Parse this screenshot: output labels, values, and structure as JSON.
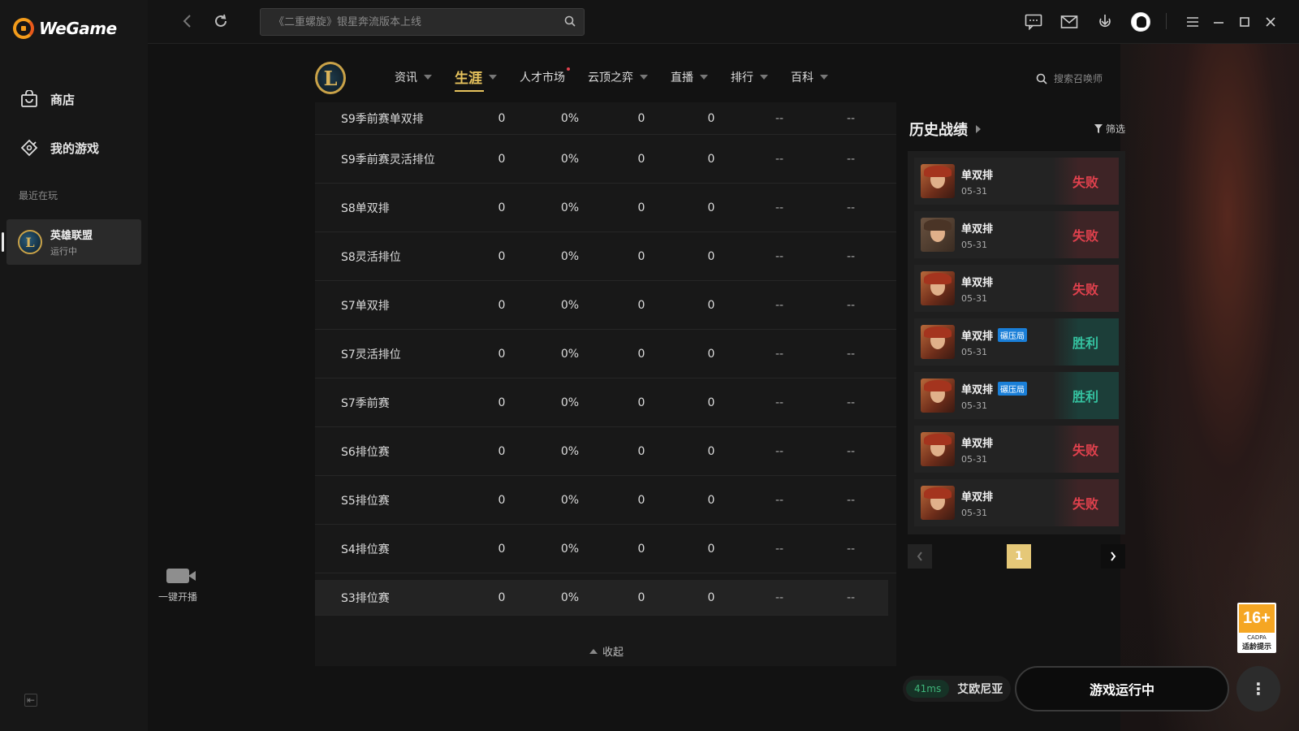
{
  "app": {
    "name": "WeGame"
  },
  "sidebar": {
    "items": [
      {
        "label": "商店",
        "icon": "store-bag-icon"
      },
      {
        "label": "我的游戏",
        "icon": "gamepad-icon"
      }
    ],
    "recent_label": "最近在玩",
    "recent_game": {
      "title": "英雄联盟",
      "status": "运行中",
      "icon": "lol-logo"
    }
  },
  "topbar": {
    "search_placeholder": "《二重螺旋》银星奔流版本上线"
  },
  "lol": {
    "tabs": [
      {
        "label": "资讯",
        "caret": true
      },
      {
        "label": "生涯",
        "caret": true,
        "active": true
      },
      {
        "label": "人才市场",
        "caret": false,
        "dot": true
      },
      {
        "label": "云顶之弈",
        "caret": true
      },
      {
        "label": "直播",
        "caret": true
      },
      {
        "label": "排行",
        "caret": true
      },
      {
        "label": "百科",
        "caret": true
      }
    ],
    "summoner_search_placeholder": "搜索召唤师"
  },
  "career_table": {
    "rows": [
      {
        "season": "S9季前赛单双排",
        "v1": "0",
        "v2": "0%",
        "v3": "0",
        "v4": "0",
        "v5": "--",
        "v6": "--"
      },
      {
        "season": "S9季前赛灵活排位",
        "v1": "0",
        "v2": "0%",
        "v3": "0",
        "v4": "0",
        "v5": "--",
        "v6": "--"
      },
      {
        "season": "S8单双排",
        "v1": "0",
        "v2": "0%",
        "v3": "0",
        "v4": "0",
        "v5": "--",
        "v6": "--"
      },
      {
        "season": "S8灵活排位",
        "v1": "0",
        "v2": "0%",
        "v3": "0",
        "v4": "0",
        "v5": "--",
        "v6": "--"
      },
      {
        "season": "S7单双排",
        "v1": "0",
        "v2": "0%",
        "v3": "0",
        "v4": "0",
        "v5": "--",
        "v6": "--"
      },
      {
        "season": "S7灵活排位",
        "v1": "0",
        "v2": "0%",
        "v3": "0",
        "v4": "0",
        "v5": "--",
        "v6": "--"
      },
      {
        "season": "S7季前赛",
        "v1": "0",
        "v2": "0%",
        "v3": "0",
        "v4": "0",
        "v5": "--",
        "v6": "--"
      },
      {
        "season": "S6排位赛",
        "v1": "0",
        "v2": "0%",
        "v3": "0",
        "v4": "0",
        "v5": "--",
        "v6": "--"
      },
      {
        "season": "S5排位赛",
        "v1": "0",
        "v2": "0%",
        "v3": "0",
        "v4": "0",
        "v5": "--",
        "v6": "--"
      },
      {
        "season": "S4排位赛",
        "v1": "0",
        "v2": "0%",
        "v3": "0",
        "v4": "0",
        "v5": "--",
        "v6": "--"
      },
      {
        "season": "S3排位赛",
        "v1": "0",
        "v2": "0%",
        "v3": "0",
        "v4": "0",
        "v5": "--",
        "v6": "--"
      }
    ],
    "collapse_label": "收起"
  },
  "history": {
    "title": "历史战绩",
    "filter_label": "筛选",
    "matches": [
      {
        "mode": "单双排",
        "date": "05-31",
        "result": "失败",
        "win": false,
        "badge": ""
      },
      {
        "mode": "单双排",
        "date": "05-31",
        "result": "失败",
        "win": false,
        "badge": "",
        "alt_champ": true
      },
      {
        "mode": "单双排",
        "date": "05-31",
        "result": "失败",
        "win": false,
        "badge": ""
      },
      {
        "mode": "单双排",
        "date": "05-31",
        "result": "胜利",
        "win": true,
        "badge": "碾压局"
      },
      {
        "mode": "单双排",
        "date": "05-31",
        "result": "胜利",
        "win": true,
        "badge": "碾压局"
      },
      {
        "mode": "单双排",
        "date": "05-31",
        "result": "失败",
        "win": false,
        "badge": ""
      },
      {
        "mode": "单双排",
        "date": "05-31",
        "result": "失败",
        "win": false,
        "badge": ""
      }
    ],
    "page": "1"
  },
  "live": {
    "label": "一键开播"
  },
  "bottom": {
    "ping": "41ms",
    "server": "艾欧尼亚",
    "running_label": "游戏运行中"
  },
  "age_rating": {
    "value": "16+",
    "small": "CADPA",
    "sub": "适龄提示"
  },
  "colors": {
    "accent": "#e7c35d",
    "lose": "#e0414d",
    "win": "#35c2a0"
  }
}
